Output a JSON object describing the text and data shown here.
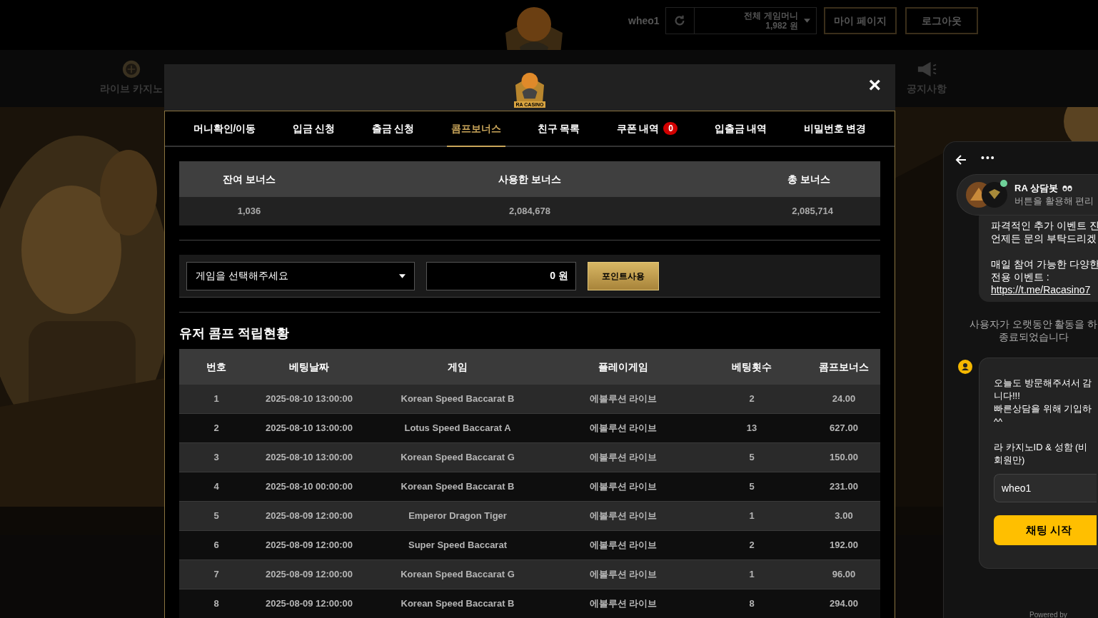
{
  "top_bar": {
    "username": "wheo1",
    "balance_label": "전체 게임머니",
    "balance_value": "1,982 원",
    "buttons": [
      "마이 페이지",
      "로그아웃"
    ]
  },
  "nav": [
    {
      "label": "라이브 카지노",
      "kind": "roulette"
    },
    {
      "label": "공지사항",
      "kind": "megaphone"
    }
  ],
  "modal": {
    "logo_text": "RA CASINO",
    "close": "×",
    "tabs": [
      {
        "label": "머니확인/이동",
        "selected": false
      },
      {
        "label": "입금 신청",
        "selected": false
      },
      {
        "label": "출금 신청",
        "selected": false
      },
      {
        "label": "콤프보너스",
        "selected": true
      },
      {
        "label": "친구 목록",
        "selected": false
      },
      {
        "label": "쿠폰 내역",
        "selected": false,
        "badge": "0"
      },
      {
        "label": "입출금 내역",
        "selected": false
      },
      {
        "label": "비밀번호 변경",
        "selected": false
      }
    ],
    "summary": {
      "columns": [
        "잔여 보너스",
        "사용한 보너스",
        "총 보너스"
      ],
      "values": [
        "1,036",
        "2,084,678",
        "2,085,714"
      ]
    },
    "form": {
      "game_select": {
        "placeholder": "게임을 선택해주세요"
      },
      "amount": "0 원",
      "button": "포인트사용"
    },
    "section_title": "유저 콤프 적립현황",
    "table": {
      "columns": [
        "번호",
        "베팅날짜",
        "게임",
        "플레이게임",
        "베팅횟수",
        "콤프보너스"
      ],
      "rows": [
        [
          "1",
          "2025-08-10 13:00:00",
          "Korean Speed Baccarat B",
          "에볼루션 라이브",
          "2",
          "24.00"
        ],
        [
          "2",
          "2025-08-10 13:00:00",
          "Lotus Speed Baccarat A",
          "에볼루션 라이브",
          "13",
          "627.00"
        ],
        [
          "3",
          "2025-08-10 13:00:00",
          "Korean Speed Baccarat G",
          "에볼루션 라이브",
          "5",
          "150.00"
        ],
        [
          "4",
          "2025-08-10 00:00:00",
          "Korean Speed Baccarat B",
          "에볼루션 라이브",
          "5",
          "231.00"
        ],
        [
          "5",
          "2025-08-09 12:00:00",
          "Emperor Dragon Tiger",
          "에볼루션 라이브",
          "1",
          "3.00"
        ],
        [
          "6",
          "2025-08-09 12:00:00",
          "Super Speed Baccarat",
          "에볼루션 라이브",
          "2",
          "192.00"
        ],
        [
          "7",
          "2025-08-09 12:00:00",
          "Korean Speed Baccarat G",
          "에볼루션 라이브",
          "1",
          "96.00"
        ],
        [
          "8",
          "2025-08-09 12:00:00",
          "Korean Speed Baccarat B",
          "에볼루션 라이브",
          "8",
          "294.00"
        ]
      ]
    }
  },
  "chat": {
    "menu": "•••",
    "bot": {
      "name": "RA 상담봇",
      "subtitle": "버튼을 활용해 편리",
      "online": true
    },
    "message_paragraphs": [
      [
        "파격적인 추가 이벤트 진",
        "언제든 문의 부탁드리겠"
      ],
      [
        "매일 참여 가능한 다양한",
        "전용 이벤트 :"
      ]
    ],
    "link": "https://t.me/Racasino7",
    "system_note": "사용자가 오랫동안 활동을 하\n종료되었습니다",
    "form_paragraphs": [
      [
        "오늘도 방문해주셔서 감",
        "니다!!!",
        "빠른상담을 위해 기입하",
        "^^"
      ],
      [
        "라 카지노ID & 성함 (비",
        "회원만)"
      ]
    ],
    "input_value": "wheo1",
    "start_button": "채팅 시작",
    "powered_by": "Powered by"
  }
}
